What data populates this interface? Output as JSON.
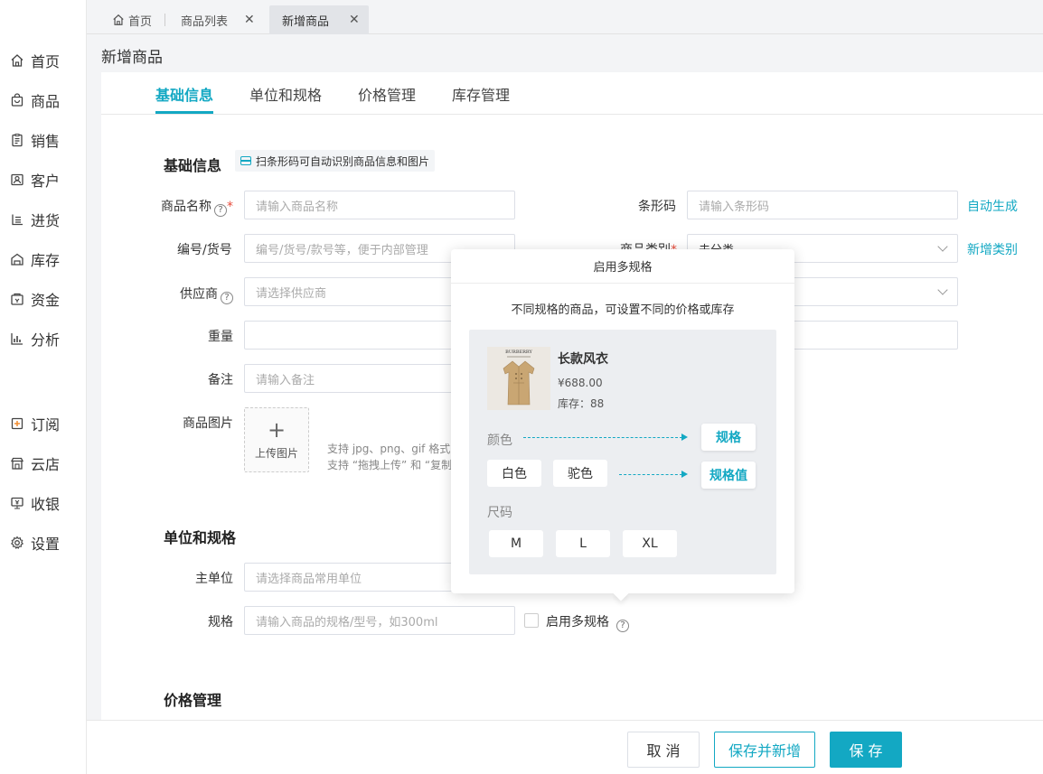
{
  "sidebar": {
    "items": [
      {
        "label": "首页",
        "icon": "home-icon"
      },
      {
        "label": "商品",
        "icon": "bag-icon"
      },
      {
        "label": "销售",
        "icon": "clipboard-icon"
      },
      {
        "label": "客户",
        "icon": "contact-card-icon"
      },
      {
        "label": "进货",
        "icon": "inbound-icon"
      },
      {
        "label": "库存",
        "icon": "warehouse-icon"
      },
      {
        "label": "资金",
        "icon": "wallet-icon"
      },
      {
        "label": "分析",
        "icon": "bar-chart-icon"
      },
      {
        "label": "订阅",
        "icon": "subscribe-icon"
      },
      {
        "label": "云店",
        "icon": "store-icon"
      },
      {
        "label": "收银",
        "icon": "cashier-icon"
      },
      {
        "label": "设置",
        "icon": "gear-icon"
      }
    ]
  },
  "tabs": {
    "home": "首页",
    "list": "商品列表",
    "active": "新增商品",
    "close": "✕"
  },
  "page": {
    "title": "新增商品"
  },
  "subtabs": [
    "基础信息",
    "单位和规格",
    "价格管理",
    "库存管理"
  ],
  "basic": {
    "title": "基础信息",
    "scan_hint": "扫条形码可自动识别商品信息和图片",
    "name_label": "商品名称",
    "name_placeholder": "请输入商品名称",
    "barcode_label": "条形码",
    "barcode_placeholder": "请输入条形码",
    "auto_generate": "自动生成",
    "code_label": "编号/货号",
    "code_placeholder": "编号/货号/款号等，便于内部管理",
    "category_label": "商品类别",
    "category_value": "未分类",
    "new_category": "新增类别",
    "supplier_label": "供应商",
    "supplier_placeholder": "请选择供应商",
    "weight_label": "重量",
    "note_label": "备注",
    "note_placeholder": "请输入备注",
    "image_label": "商品图片",
    "upload_plus": "+",
    "upload_label": "上传图片",
    "upload_note1": "支持 jpg、png、gif 格式",
    "upload_note2": "支持 “拖拽上传” 和 “复制粘贴"
  },
  "unit": {
    "title": "单位和规格",
    "main_unit_label": "主单位",
    "main_unit_placeholder": "请选择商品常用单位",
    "spec_label": "规格",
    "spec_placeholder": "请输入商品的规格/型号，如300ml",
    "multi_spec_label": "启用多规格"
  },
  "price": {
    "title": "价格管理"
  },
  "footer": {
    "cancel": "取 消",
    "save_new": "保存并新增",
    "save": "保 存"
  },
  "popover": {
    "title": "启用多规格",
    "subtitle": "不同规格的商品，可设置不同的价格或库存",
    "product_name": "长款风衣",
    "product_brand": "BURBERRY",
    "product_price": "¥688.00",
    "product_stock": "库存：88",
    "color_label": "颜色",
    "spec_tag": "规格",
    "white": "白色",
    "camel": "驼色",
    "spec_value_tag": "规格值",
    "size_label": "尺码",
    "sizes": [
      "M",
      "L",
      "XL"
    ]
  },
  "colors": {
    "accent": "#13a8c3",
    "required": "#e74c3c"
  }
}
